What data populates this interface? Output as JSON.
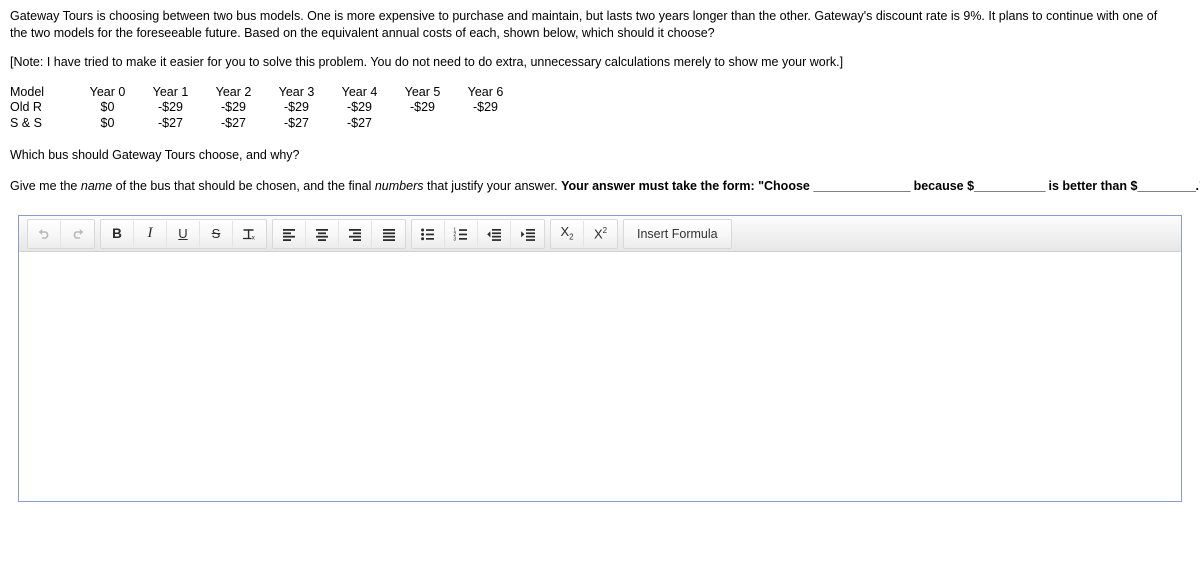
{
  "problem": {
    "paragraph1": "Gateway Tours is choosing between two bus models.  One is more expensive to purchase and maintain, but lasts two years longer than the other.  Gateway's discount rate is 9%.  It plans to continue with one of the two models for the foreseeable future.  Based on the equivalent annual costs of each, shown below, which should it choose?",
    "note": "[Note:  I have tried to make it easier for you to solve this problem.  You do not need to do extra, unnecessary calculations merely to show me your work.]",
    "question": "Which bus should Gateway Tours choose, and why?",
    "instruction": {
      "part1": "Give me the ",
      "italic1": "name",
      "part2": " of the bus that should be chosen, and the final ",
      "italic2": "numbers",
      "part3": " that justify your answer.  ",
      "bold_lead": "Your answer must take the form:  \"Choose ",
      "blank1": "_______________",
      "bold_mid1": " because $",
      "blank2": "___________",
      "bold_mid2": " is better than $",
      "blank3": "_________",
      "bold_end": ".\""
    }
  },
  "cashflow_table": {
    "headers": [
      "Model",
      "Year 0",
      "Year 1",
      "Year 2",
      "Year 3",
      "Year 4",
      "Year 5",
      "Year 6"
    ],
    "rows": [
      {
        "label": "Old R",
        "values": [
          "$0",
          "-$29",
          "-$29",
          "-$29",
          "-$29",
          "-$29",
          "-$29"
        ]
      },
      {
        "label": "S & S",
        "values": [
          "$0",
          "-$27",
          "-$27",
          "-$27",
          "-$27",
          "",
          ""
        ]
      }
    ]
  },
  "editor": {
    "content": "",
    "placeholder": "",
    "toolbar": {
      "groups": [
        {
          "name": "history",
          "buttons": [
            {
              "name": "undo-icon",
              "label": "Undo",
              "disabled": true
            },
            {
              "name": "redo-icon",
              "label": "Redo",
              "disabled": true
            }
          ]
        },
        {
          "name": "text-format",
          "buttons": [
            {
              "name": "bold-icon",
              "label": "B",
              "disabled": false
            },
            {
              "name": "italic-icon",
              "label": "I",
              "disabled": false
            },
            {
              "name": "underline-icon",
              "label": "U",
              "disabled": false
            },
            {
              "name": "strikethrough-icon",
              "label": "S",
              "disabled": false
            },
            {
              "name": "remove-format-icon",
              "label": "Tx",
              "disabled": false
            }
          ]
        },
        {
          "name": "alignment",
          "buttons": [
            {
              "name": "align-left-icon",
              "label": "Align Left",
              "disabled": false
            },
            {
              "name": "align-center-icon",
              "label": "Align Center",
              "disabled": false
            },
            {
              "name": "align-right-icon",
              "label": "Align Right",
              "disabled": false
            },
            {
              "name": "align-justify-icon",
              "label": "Justify",
              "disabled": false
            }
          ]
        },
        {
          "name": "lists-indent",
          "buttons": [
            {
              "name": "bulleted-list-icon",
              "label": "Bulleted List",
              "disabled": false
            },
            {
              "name": "numbered-list-icon",
              "label": "Numbered List",
              "disabled": false
            },
            {
              "name": "outdent-icon",
              "label": "Decrease Indent",
              "disabled": false
            },
            {
              "name": "indent-icon",
              "label": "Increase Indent",
              "disabled": false
            }
          ]
        },
        {
          "name": "script",
          "buttons": [
            {
              "name": "subscript-icon",
              "label": "X2",
              "disabled": false
            },
            {
              "name": "superscript-icon",
              "label": "X2",
              "disabled": false
            }
          ]
        },
        {
          "name": "formula",
          "buttons": [
            {
              "name": "insert-formula-button",
              "label": "Insert Formula",
              "disabled": false
            }
          ]
        }
      ]
    }
  },
  "colors": {
    "editor_border": "#8a9dc4",
    "toolbar_bg": "#f3f3f3",
    "text": "#000000"
  }
}
